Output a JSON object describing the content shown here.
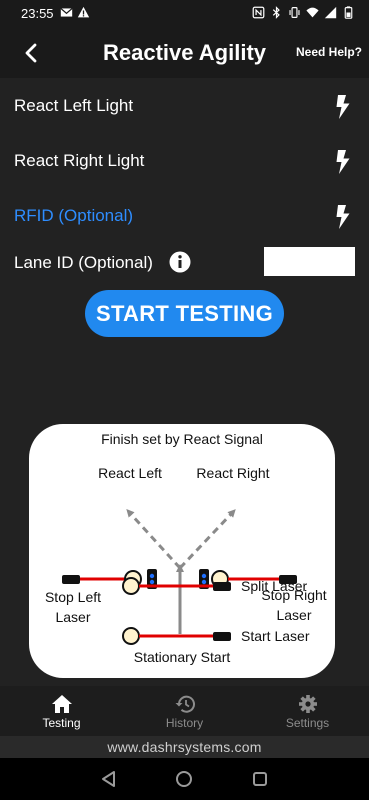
{
  "status_bar": {
    "time": "23:55",
    "left_icons": [
      "gmail-icon",
      "alert-icon"
    ],
    "right_icons": [
      "nfc-icon",
      "bluetooth-icon",
      "vibrate-icon",
      "wifi-icon",
      "signal-icon",
      "battery-icon"
    ]
  },
  "header": {
    "title": "Reactive Agility",
    "help_label": "Need Help?"
  },
  "settings": {
    "rows": [
      {
        "label": "React Left Light",
        "icon": "bolt-icon"
      },
      {
        "label": "React Right Light",
        "icon": "bolt-icon"
      },
      {
        "label": "RFID (Optional)",
        "icon": "bolt-icon"
      }
    ],
    "lane_id": {
      "label": "Lane ID (Optional)",
      "value": "",
      "placeholder": ""
    },
    "start_label": "START TESTING"
  },
  "diagram": {
    "title": "Finish set by React Signal",
    "react_left": "React Left",
    "react_right": "React Right",
    "stop_left_line1": "Stop Left",
    "stop_left_line2": "Laser",
    "stop_right_line1": "Stop Right",
    "stop_right_line2": "Laser",
    "split_laser": "Split Laser",
    "start_laser": "Start Laser",
    "stationary_start": "Stationary Start"
  },
  "nav": {
    "items": [
      {
        "label": "Testing",
        "icon": "home-icon",
        "active": true
      },
      {
        "label": "History",
        "icon": "history-icon",
        "active": false
      },
      {
        "label": "Settings",
        "icon": "gear-icon",
        "active": false
      }
    ]
  },
  "footer": {
    "url": "www.dashrsystems.com"
  },
  "colors": {
    "accent": "#2189ef",
    "link_blue": "#2e8dff",
    "laser_red": "#e00000",
    "background": "#222222"
  }
}
